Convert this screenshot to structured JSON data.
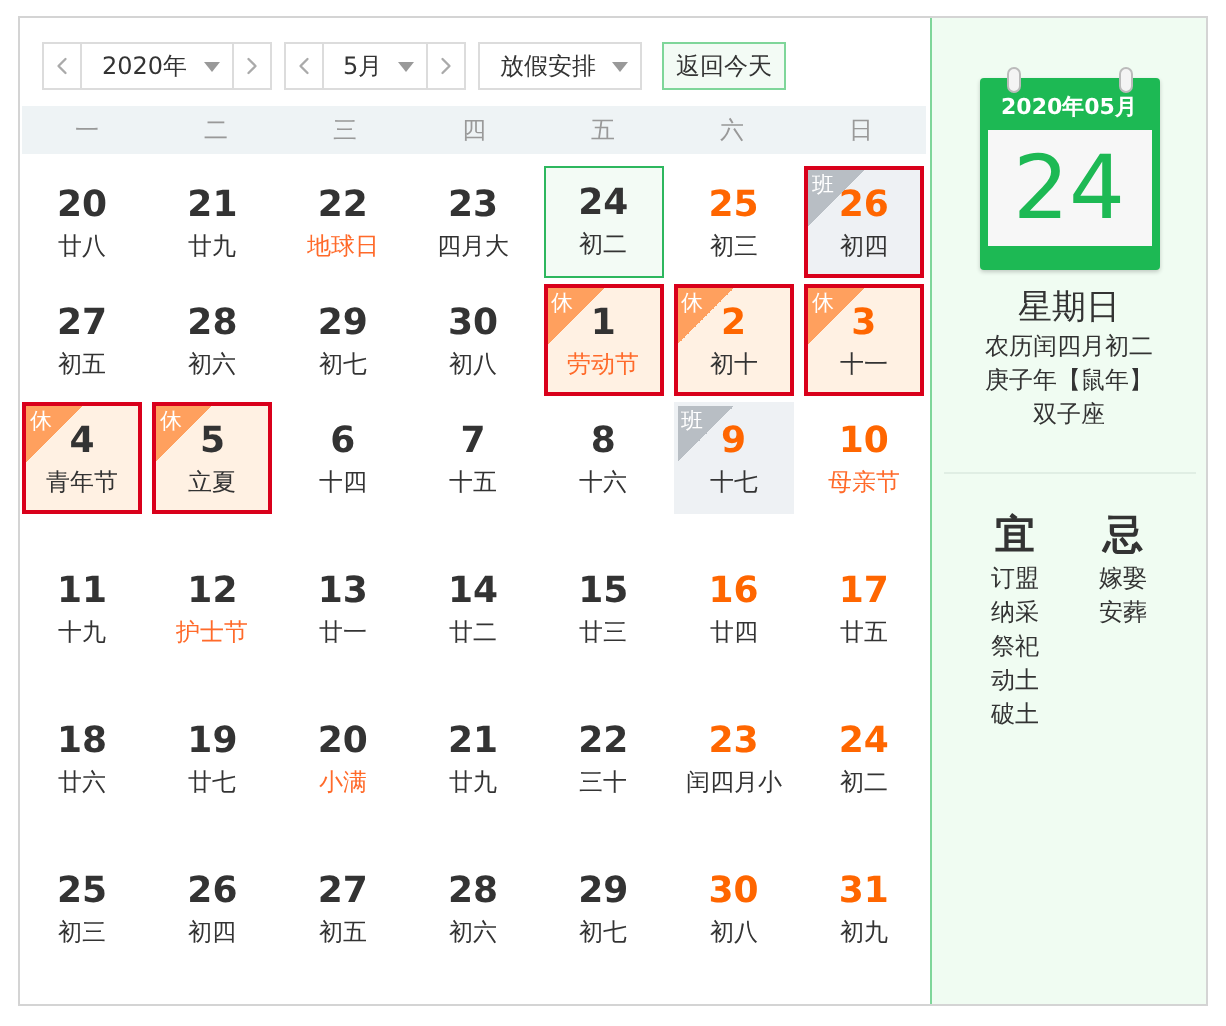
{
  "toolbar": {
    "year": {
      "value": "2020年"
    },
    "month": {
      "value": "5月"
    },
    "holiday": {
      "value": "放假安排"
    },
    "today_button": "返回今天"
  },
  "weekdays": [
    "一",
    "二",
    "三",
    "四",
    "五",
    "六",
    "日"
  ],
  "weeks": [
    [
      {
        "day": "20",
        "lunar": "廿八",
        "weekend": false,
        "festival": false,
        "today": false,
        "selected": false
      },
      {
        "day": "21",
        "lunar": "廿九",
        "weekend": false,
        "festival": false,
        "today": false,
        "selected": false
      },
      {
        "day": "22",
        "lunar": "地球日",
        "weekend": false,
        "festival": true,
        "today": false,
        "selected": false
      },
      {
        "day": "23",
        "lunar": "四月大",
        "weekend": false,
        "festival": false,
        "today": false,
        "selected": false
      },
      {
        "day": "24",
        "lunar": "初二",
        "weekend": false,
        "festival": false,
        "today": true,
        "selected": false
      },
      {
        "day": "25",
        "lunar": "初三",
        "weekend": true,
        "festival": false,
        "today": false,
        "selected": false
      },
      {
        "day": "26",
        "lunar": "初四",
        "weekend": true,
        "festival": false,
        "today": false,
        "selected": true,
        "badge": {
          "kind": "work",
          "text": "班"
        }
      }
    ],
    [
      {
        "day": "27",
        "lunar": "初五",
        "weekend": false,
        "festival": false,
        "today": false,
        "selected": false
      },
      {
        "day": "28",
        "lunar": "初六",
        "weekend": false,
        "festival": false,
        "today": false,
        "selected": false
      },
      {
        "day": "29",
        "lunar": "初七",
        "weekend": false,
        "festival": false,
        "today": false,
        "selected": false
      },
      {
        "day": "30",
        "lunar": "初八",
        "weekend": false,
        "festival": false,
        "today": false,
        "selected": false
      },
      {
        "day": "1",
        "lunar": "劳动节",
        "weekend": false,
        "festival": true,
        "today": false,
        "selected": true,
        "badge": {
          "kind": "rest",
          "text": "休"
        }
      },
      {
        "day": "2",
        "lunar": "初十",
        "weekend": true,
        "festival": false,
        "today": false,
        "selected": true,
        "badge": {
          "kind": "rest",
          "text": "休"
        }
      },
      {
        "day": "3",
        "lunar": "十一",
        "weekend": true,
        "festival": false,
        "today": false,
        "selected": true,
        "badge": {
          "kind": "rest",
          "text": "休"
        }
      }
    ],
    [
      {
        "day": "4",
        "lunar": "青年节",
        "weekend": false,
        "festival": false,
        "today": false,
        "selected": true,
        "badge": {
          "kind": "rest",
          "text": "休"
        }
      },
      {
        "day": "5",
        "lunar": "立夏",
        "weekend": false,
        "festival": false,
        "today": false,
        "selected": true,
        "badge": {
          "kind": "rest",
          "text": "休"
        }
      },
      {
        "day": "6",
        "lunar": "十四",
        "weekend": false,
        "festival": false,
        "today": false,
        "selected": false
      },
      {
        "day": "7",
        "lunar": "十五",
        "weekend": false,
        "festival": false,
        "today": false,
        "selected": false
      },
      {
        "day": "8",
        "lunar": "十六",
        "weekend": false,
        "festival": false,
        "today": false,
        "selected": false
      },
      {
        "day": "9",
        "lunar": "十七",
        "weekend": true,
        "festival": false,
        "today": false,
        "selected": false,
        "badge": {
          "kind": "work",
          "text": "班"
        }
      },
      {
        "day": "10",
        "lunar": "母亲节",
        "weekend": true,
        "festival": true,
        "today": false,
        "selected": false
      }
    ],
    [
      {
        "day": "11",
        "lunar": "十九",
        "weekend": false,
        "festival": false,
        "today": false,
        "selected": false
      },
      {
        "day": "12",
        "lunar": "护士节",
        "weekend": false,
        "festival": true,
        "today": false,
        "selected": false
      },
      {
        "day": "13",
        "lunar": "廿一",
        "weekend": false,
        "festival": false,
        "today": false,
        "selected": false
      },
      {
        "day": "14",
        "lunar": "廿二",
        "weekend": false,
        "festival": false,
        "today": false,
        "selected": false
      },
      {
        "day": "15",
        "lunar": "廿三",
        "weekend": false,
        "festival": false,
        "today": false,
        "selected": false
      },
      {
        "day": "16",
        "lunar": "廿四",
        "weekend": true,
        "festival": false,
        "today": false,
        "selected": false
      },
      {
        "day": "17",
        "lunar": "廿五",
        "weekend": true,
        "festival": false,
        "today": false,
        "selected": false
      }
    ],
    [
      {
        "day": "18",
        "lunar": "廿六",
        "weekend": false,
        "festival": false,
        "today": false,
        "selected": false
      },
      {
        "day": "19",
        "lunar": "廿七",
        "weekend": false,
        "festival": false,
        "today": false,
        "selected": false
      },
      {
        "day": "20",
        "lunar": "小满",
        "weekend": false,
        "festival": true,
        "today": false,
        "selected": false
      },
      {
        "day": "21",
        "lunar": "廿九",
        "weekend": false,
        "festival": false,
        "today": false,
        "selected": false
      },
      {
        "day": "22",
        "lunar": "三十",
        "weekend": false,
        "festival": false,
        "today": false,
        "selected": false
      },
      {
        "day": "23",
        "lunar": "闰四月小",
        "weekend": true,
        "festival": false,
        "today": false,
        "selected": false
      },
      {
        "day": "24",
        "lunar": "初二",
        "weekend": true,
        "festival": false,
        "today": false,
        "selected": false
      }
    ],
    [
      {
        "day": "25",
        "lunar": "初三",
        "weekend": false,
        "festival": false,
        "today": false,
        "selected": false
      },
      {
        "day": "26",
        "lunar": "初四",
        "weekend": false,
        "festival": false,
        "today": false,
        "selected": false
      },
      {
        "day": "27",
        "lunar": "初五",
        "weekend": false,
        "festival": false,
        "today": false,
        "selected": false
      },
      {
        "day": "28",
        "lunar": "初六",
        "weekend": false,
        "festival": false,
        "today": false,
        "selected": false
      },
      {
        "day": "29",
        "lunar": "初七",
        "weekend": false,
        "festival": false,
        "today": false,
        "selected": false
      },
      {
        "day": "30",
        "lunar": "初八",
        "weekend": true,
        "festival": false,
        "today": false,
        "selected": false
      },
      {
        "day": "31",
        "lunar": "初九",
        "weekend": true,
        "festival": false,
        "today": false,
        "selected": false
      }
    ]
  ],
  "detail": {
    "month": "2020年05月",
    "day": "24",
    "weekday": "星期日",
    "lunar": "农历闰四月初二",
    "year": "庚子年【鼠年】",
    "zodiac": "双子座",
    "good": {
      "title": "宜",
      "items": [
        "订盟",
        "纳采",
        "祭祀",
        "动土",
        "破土"
      ]
    },
    "bad": {
      "title": "忌",
      "items": [
        "嫁娶",
        "安葬"
      ]
    }
  }
}
